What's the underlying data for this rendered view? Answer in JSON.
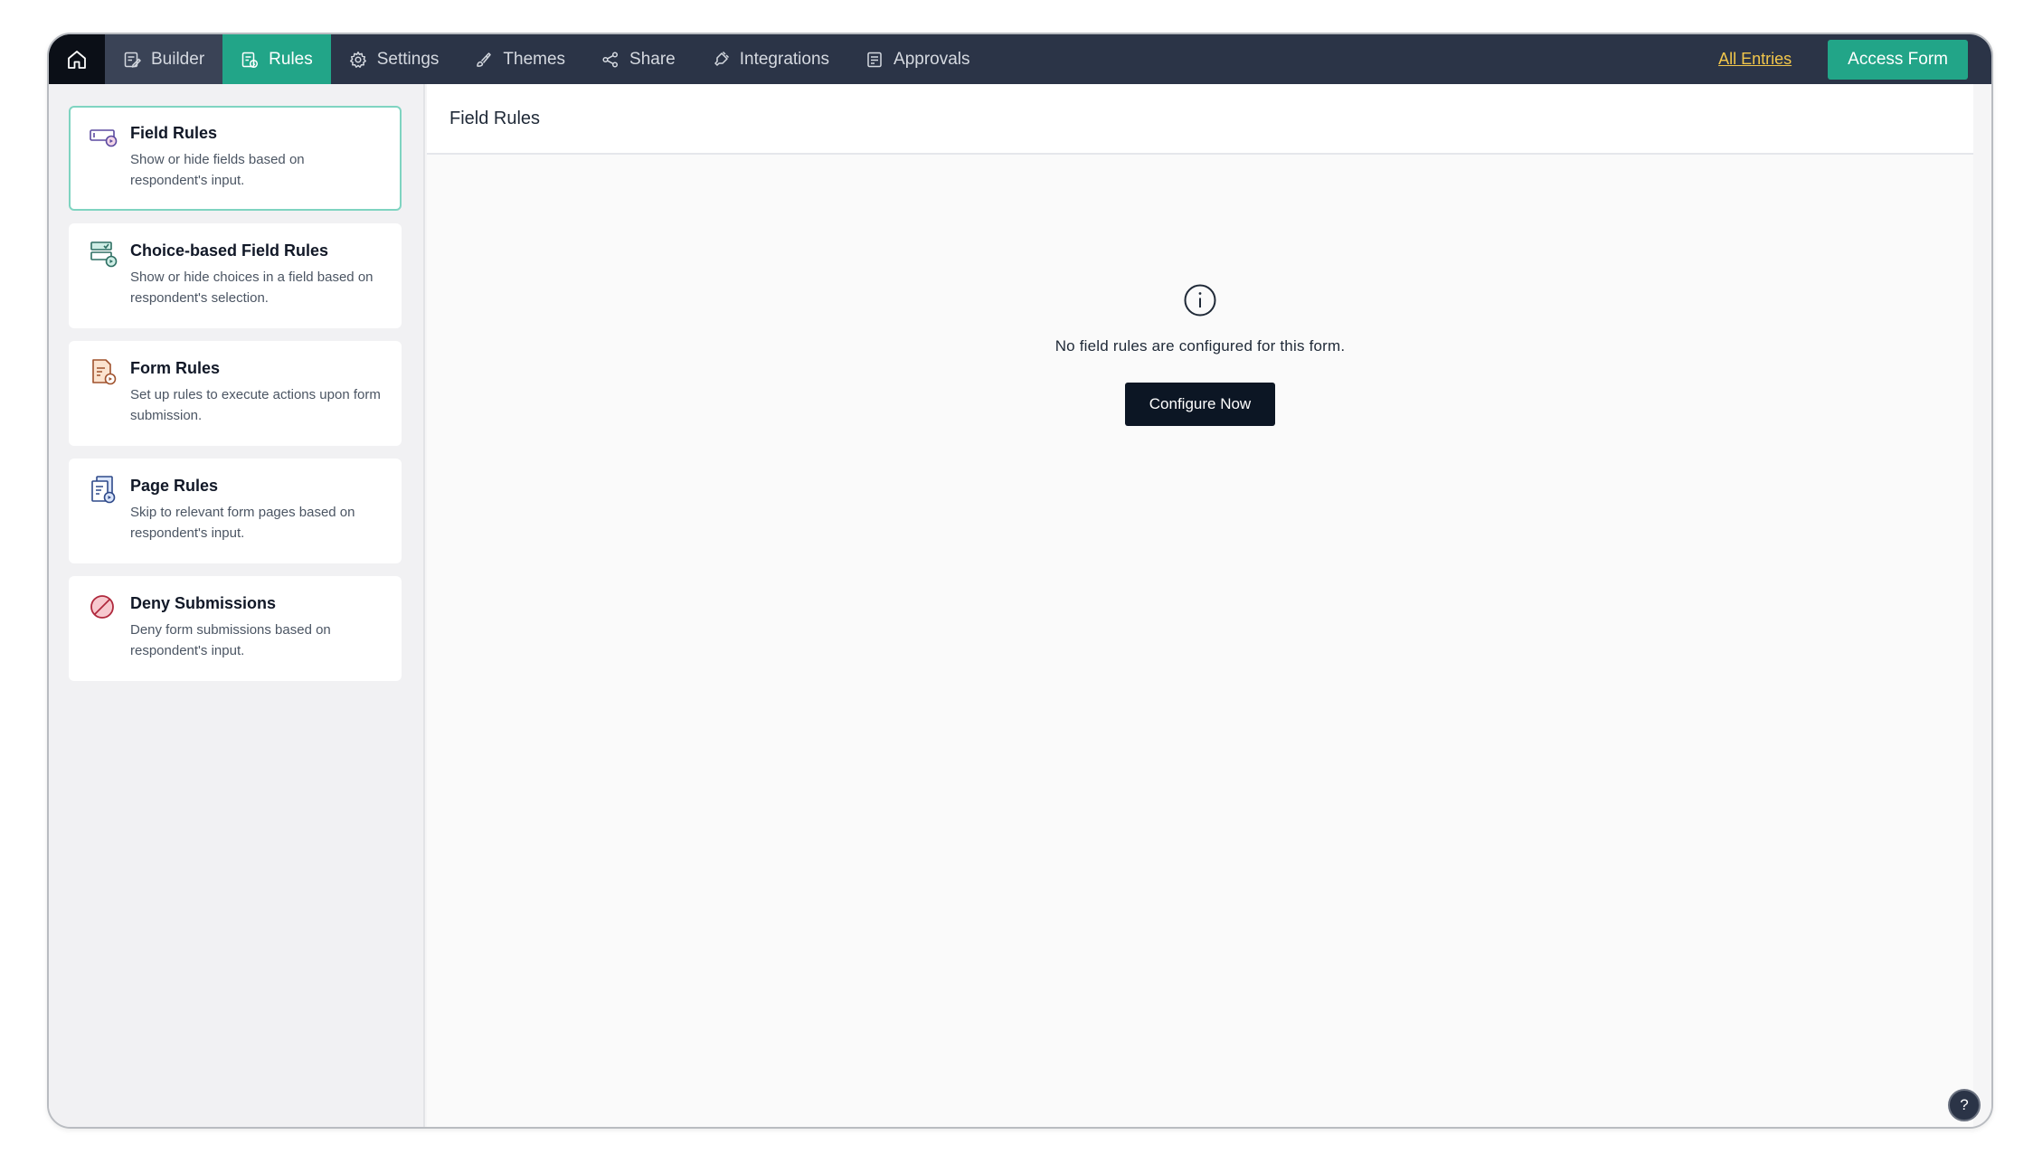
{
  "nav": {
    "items": [
      {
        "label": "Builder",
        "icon": "builder-icon"
      },
      {
        "label": "Rules",
        "icon": "rules-icon"
      },
      {
        "label": "Settings",
        "icon": "settings-icon"
      },
      {
        "label": "Themes",
        "icon": "themes-icon"
      },
      {
        "label": "Share",
        "icon": "share-icon"
      },
      {
        "label": "Integrations",
        "icon": "integrations-icon"
      },
      {
        "label": "Approvals",
        "icon": "approvals-icon"
      }
    ],
    "active": "Rules",
    "all_entries": "All Entries",
    "access_form": "Access Form"
  },
  "sidebar": {
    "cards": [
      {
        "title": "Field Rules",
        "desc": "Show or hide fields based on respondent's input.",
        "icon": "field-rules-icon",
        "active": true
      },
      {
        "title": "Choice-based Field Rules",
        "desc": "Show or hide choices in a field based on respondent's selection.",
        "icon": "choice-rules-icon",
        "active": false
      },
      {
        "title": "Form Rules",
        "desc": "Set up rules to execute actions upon form submission.",
        "icon": "form-rules-icon",
        "active": false
      },
      {
        "title": "Page Rules",
        "desc": "Skip to relevant form pages based on respondent's input.",
        "icon": "page-rules-icon",
        "active": false
      },
      {
        "title": "Deny Submissions",
        "desc": "Deny form submissions based on respondent's input.",
        "icon": "deny-icon",
        "active": false
      }
    ]
  },
  "main": {
    "title": "Field Rules",
    "empty_message": "No field rules are configured for this form.",
    "configure_label": "Configure Now"
  },
  "help": {
    "label": "?"
  },
  "colors": {
    "nav_bg": "#2b3447",
    "accent": "#22a588",
    "link": "#f2c64b",
    "button_dark": "#0c1624"
  }
}
